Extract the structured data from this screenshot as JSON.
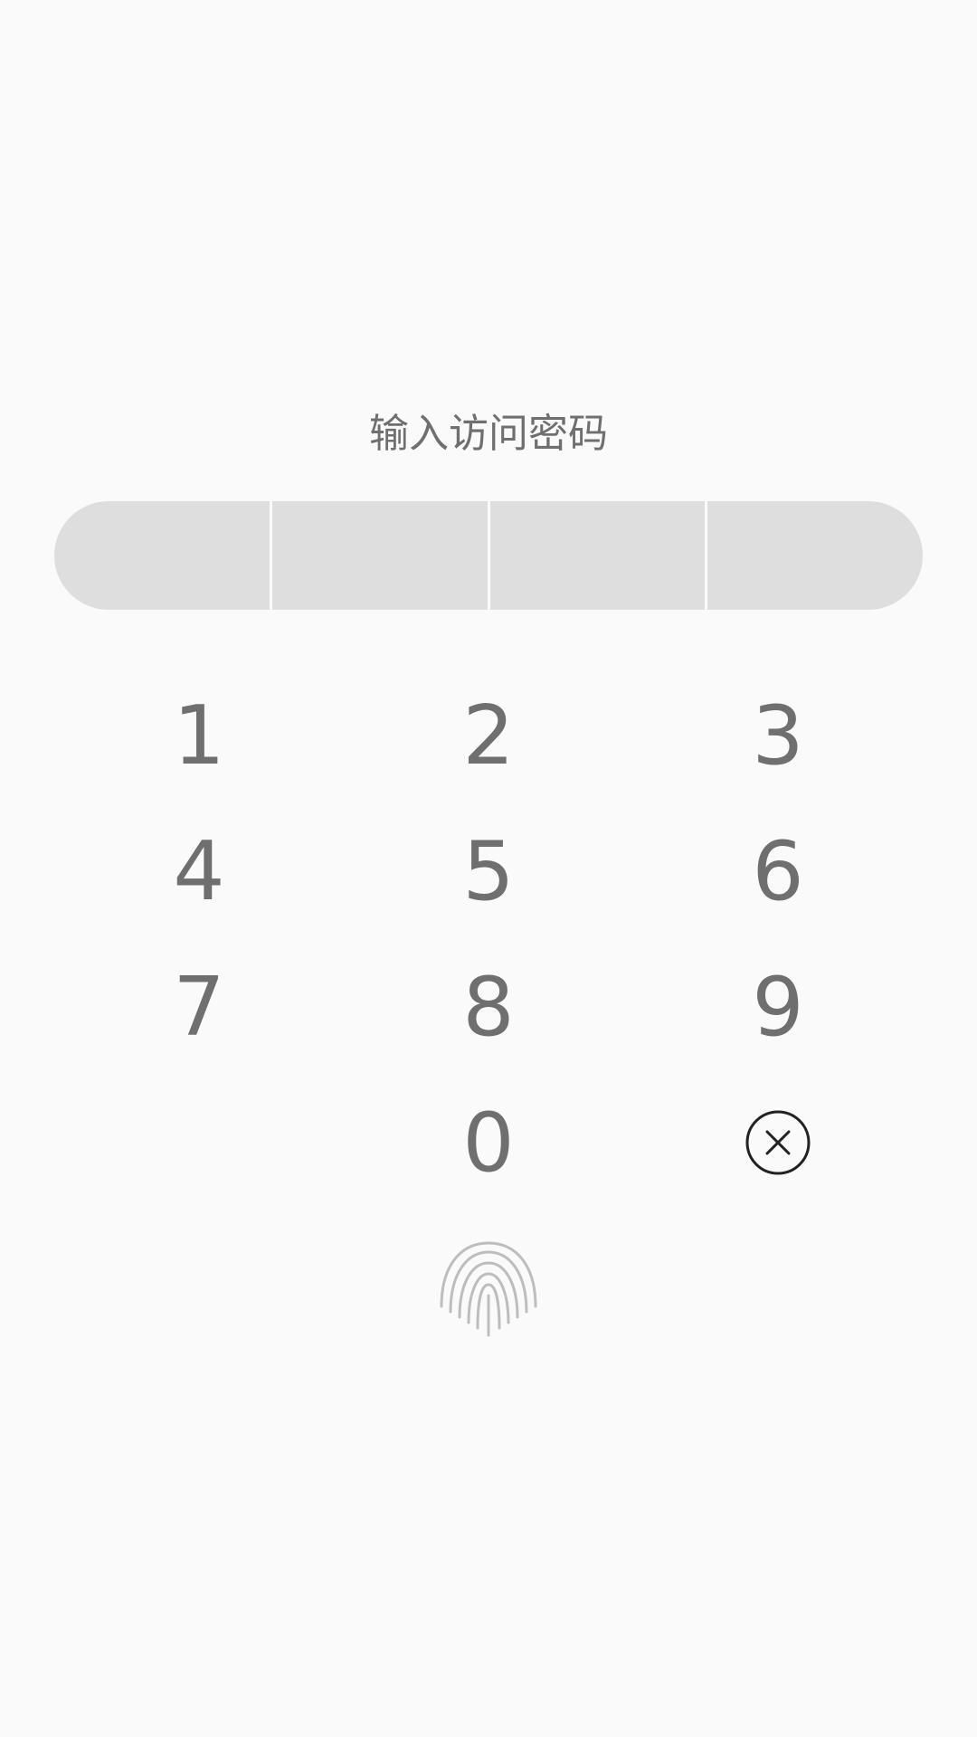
{
  "lock_screen": {
    "title": "输入访问密码",
    "pin_slots": 4
  },
  "keypad": {
    "keys": [
      "1",
      "2",
      "3",
      "4",
      "5",
      "6",
      "7",
      "8",
      "9",
      "",
      "0",
      "delete"
    ]
  },
  "icons": {
    "delete": "clear-circle-icon",
    "fingerprint": "fingerprint-icon"
  },
  "colors": {
    "background": "#fafafa",
    "text": "#6f6f6f",
    "pin_slot": "#dedede",
    "delete_icon": "#222222",
    "fingerprint": "#bdbdbd"
  }
}
